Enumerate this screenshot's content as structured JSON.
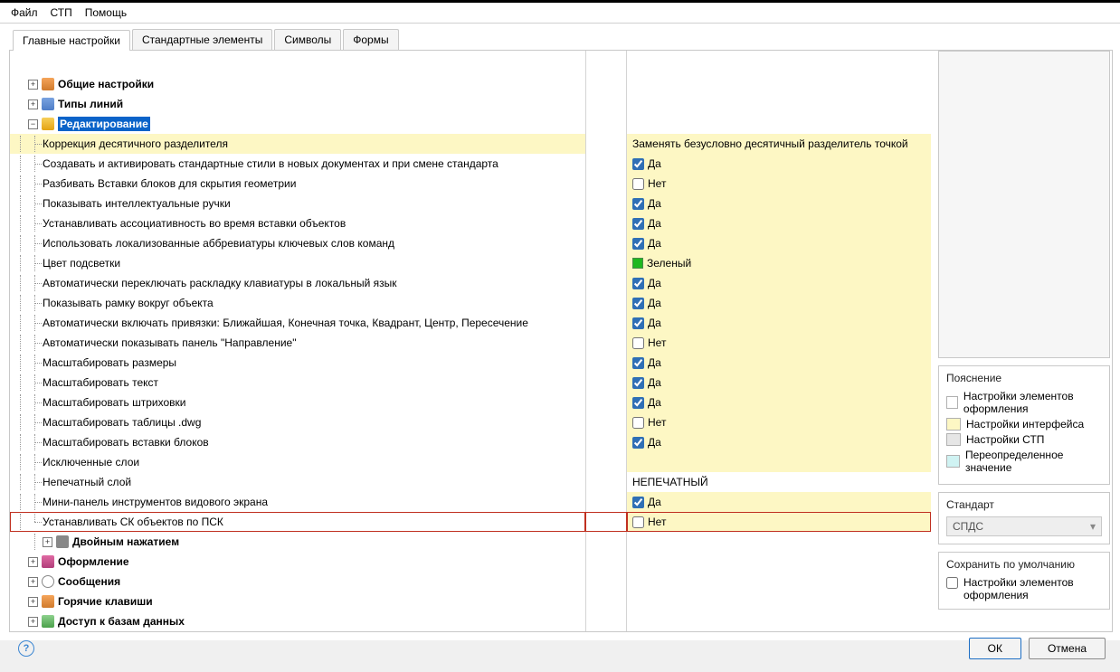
{
  "menubar": [
    "Файл",
    "СТП",
    "Помощь"
  ],
  "tabs": [
    "Главные настройки",
    "Стандартные элементы",
    "Символы",
    "Формы"
  ],
  "active_tab": 0,
  "tree": {
    "top": [
      {
        "id": "general",
        "label": "Общие настройки",
        "icon": "ico-gear",
        "expander": "+",
        "bold": true
      },
      {
        "id": "linetypes",
        "label": "Типы линий",
        "icon": "ico-lines",
        "expander": "+",
        "bold": true
      },
      {
        "id": "editing",
        "label": "Редактирование",
        "icon": "ico-edit",
        "expander": "-",
        "bold": true,
        "selected": true
      }
    ],
    "editing_children": [
      {
        "label": "Коррекция десятичного разделителя",
        "value_text": "Заменять безусловно десятичный разделитель точкой",
        "hl": "hl2"
      },
      {
        "label": "Создавать и активировать стандартные стили в новых документах и при смене стандарта",
        "value_checked": true,
        "value_label": "Да"
      },
      {
        "label": "Разбивать Вставки блоков для скрытия геометрии",
        "value_checked": false,
        "value_label": "Нет"
      },
      {
        "label": "Показывать интеллектуальные ручки",
        "value_checked": true,
        "value_label": "Да"
      },
      {
        "label": "Устанавливать ассоциативность во время вставки объектов",
        "value_checked": true,
        "value_label": "Да"
      },
      {
        "label": "Использовать локализованные аббревиатуры ключевых слов команд",
        "value_checked": true,
        "value_label": "Да"
      },
      {
        "label": "Цвет подсветки",
        "value_color": "green",
        "value_label": "Зеленый"
      },
      {
        "label": "Автоматически переключать раскладку клавиатуры в локальный язык",
        "value_checked": true,
        "value_label": "Да"
      },
      {
        "label": "Показывать рамку вокруг объекта",
        "value_checked": true,
        "value_label": "Да"
      },
      {
        "label": "Автоматически включать привязки: Ближайшая, Конечная точка, Квадрант, Центр, Пересечение",
        "value_checked": true,
        "value_label": "Да"
      },
      {
        "label": "Автоматически показывать панель \"Направление\"",
        "value_checked": false,
        "value_label": "Нет"
      },
      {
        "label": "Масштабировать размеры",
        "value_checked": true,
        "value_label": "Да"
      },
      {
        "label": "Масштабировать текст",
        "value_checked": true,
        "value_label": "Да"
      },
      {
        "label": "Масштабировать штриховки",
        "value_checked": true,
        "value_label": "Да"
      },
      {
        "label": "Масштабировать таблицы .dwg",
        "value_checked": false,
        "value_label": "Нет"
      },
      {
        "label": "Масштабировать вставки блоков",
        "value_checked": true,
        "value_label": "Да"
      },
      {
        "label": "Исключенные слои",
        "value_text": ""
      },
      {
        "label": "Непечатный слой",
        "value_text": "НЕПЕЧАТНЫЙ",
        "hl": "none"
      },
      {
        "label": "Мини-панель инструментов видового экрана",
        "value_checked": true,
        "value_label": "Да"
      },
      {
        "label": "Устанавливать СК объектов по ПСК",
        "value_checked": false,
        "value_label": "Нет",
        "redbox": true
      }
    ],
    "bottom": [
      {
        "id": "dblclick",
        "label": "Двойным нажатием",
        "icon": "ico-cursor",
        "expander": "+",
        "bold": true,
        "indent": 1
      },
      {
        "id": "format",
        "label": "Оформление",
        "icon": "ico-format",
        "expander": "+",
        "bold": true
      },
      {
        "id": "messages",
        "label": "Сообщения",
        "icon": "ico-msg",
        "expander": "+",
        "bold": true
      },
      {
        "id": "hotkeys",
        "label": "Горячие клавиши",
        "icon": "ico-hotkey",
        "expander": "+",
        "bold": true
      },
      {
        "id": "db",
        "label": "Доступ к базам данных",
        "icon": "ico-db",
        "expander": "+",
        "bold": true
      }
    ]
  },
  "sidebar": {
    "legend_title": "Пояснение",
    "legend_items": [
      {
        "swatch": "sw-white",
        "label": "Настройки элементов оформления"
      },
      {
        "swatch": "sw-yellow",
        "label": "Настройки интерфейса"
      },
      {
        "swatch": "sw-grey",
        "label": "Настройки СТП"
      },
      {
        "swatch": "sw-cyan",
        "label": "Переопределенное значение"
      }
    ],
    "standard_title": "Стандарт",
    "standard_value": "СПДС",
    "save_default_title": "Сохранить по умолчанию",
    "save_default_checkbox": "Настройки элементов оформления",
    "save_default_checked": false
  },
  "buttons": {
    "ok": "ОК",
    "cancel": "Отмена"
  }
}
